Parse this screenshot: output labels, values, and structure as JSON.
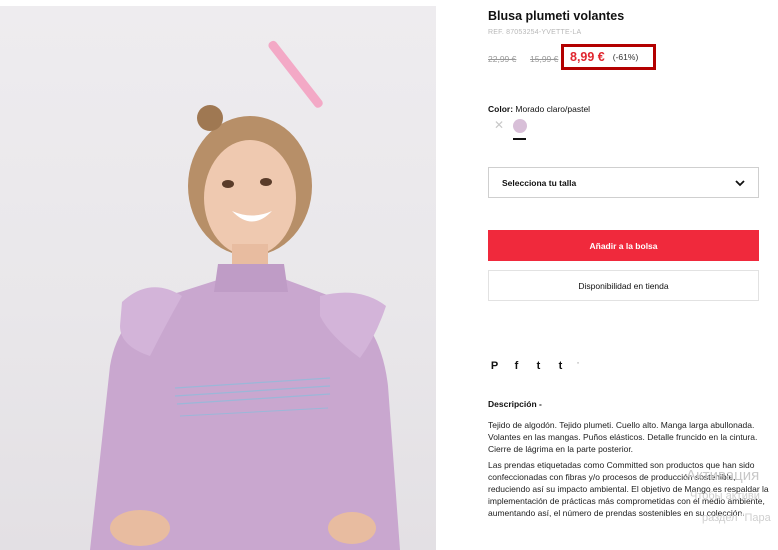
{
  "product": {
    "title": "Blusa plumeti volantes",
    "ref": "REF. 87053254-YVETTE-LA",
    "price_original": "22,99 €",
    "price_previous": "15,99 €",
    "price_current": "8,99 €",
    "discount": "(-61%)",
    "color_label": "Color:",
    "color_value": "Morado claro/pastel",
    "color_swatch": "#d8bfd8",
    "accent_color": "#f0293c",
    "highlight_box_color": "#b30000"
  },
  "actions": {
    "size_placeholder": "Selecciona tu talla",
    "add_to_bag": "Añadir a la bolsa",
    "store_availability": "Disponibilidad en tienda"
  },
  "share": {
    "icons": [
      "pinterest-icon",
      "facebook-icon",
      "twitter-icon",
      "tumblr-icon"
    ],
    "pinterest": "P",
    "facebook": "f",
    "twitter": "t",
    "tumblr": "t",
    "more": "'"
  },
  "description": {
    "heading": "Descripción  -",
    "paragraph1": "Tejido de algodón. Tejido plumeti. Cuello alto. Manga larga abullonada. Volantes en las mangas. Puños elásticos. Detalle fruncido en la cintura. Cierre de lágrima en la parte posterior.",
    "paragraph2": "Las prendas etiquetadas como Committed son productos que han sido confeccionadas con fibras y/o procesos de producción sostenible, reduciendo así su impacto ambiental. El objetivo de Mango es respaldar la implementación de prácticas más comprometidas con el medio ambiente, aumentando así, el número de prendas sostenibles en su colección."
  },
  "overlay": {
    "line1": "Активация",
    "line2": "Чтобы активи",
    "line3": "раздел \"Пара"
  }
}
